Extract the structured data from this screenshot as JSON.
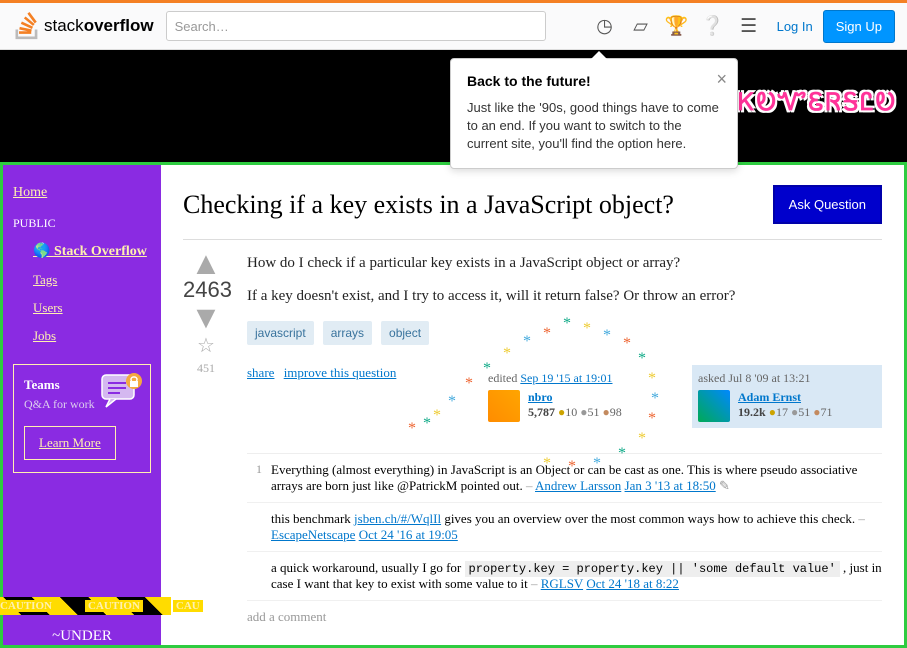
{
  "header": {
    "logo_text_a": "stack",
    "logo_text_b": "overflow",
    "search_placeholder": "Search…",
    "login": "Log In",
    "signup": "Sign Up"
  },
  "tooltip": {
    "title": "Back to the future!",
    "body": "Just like the '90s, good things have to come to an end. If you want to switch to the current site, you'll find the option here."
  },
  "retro_logo": "ᏦᎧᏉᏋᏒᎦᏝᎧ",
  "sidebar": {
    "home": "Home",
    "public": "PUBLIC",
    "so": "Stack Overflow",
    "tags": "Tags",
    "users": "Users",
    "jobs": "Jobs",
    "teams_title": "Teams",
    "teams_sub": "Q&A for work",
    "learn_more": "Learn More",
    "caution": "CAUTION",
    "under": "~UNDER"
  },
  "question": {
    "title": "Checking if a key exists in a JavaScript object?",
    "ask": "Ask Question",
    "votes": "2463",
    "favs": "451",
    "p1": "How do I check if a particular key exists in a JavaScript object or array?",
    "p2": "If a key doesn't exist, and I try to access it, will it return false? Or throw an error?",
    "tags": [
      "javascript",
      "arrays",
      "object"
    ],
    "share": "share",
    "improve": "improve this question"
  },
  "editor": {
    "action": "edited",
    "time": "Sep 19 '15 at 19:01",
    "name": "nbro",
    "rep": "5,787",
    "gold": "10",
    "silver": "51",
    "bronze": "98"
  },
  "asker": {
    "action": "asked",
    "time": "Jul 8 '09 at 13:21",
    "name": "Adam Ernst",
    "rep": "19.2k",
    "gold": "17",
    "silver": "51",
    "bronze": "71"
  },
  "comments": [
    {
      "score": "1",
      "text": "Everything (almost everything) in JavaScript is an Object or can be cast as one. This is where pseudo associative arrays are born just like @PatrickM pointed out.",
      "by": "Andrew Larsson",
      "time": "Jan 3 '13 at 18:50"
    },
    {
      "score": "",
      "text_a": "this benchmark ",
      "link": "jsben.ch/#/WqlIl",
      "text_b": " gives you an overview over the most common ways how to achieve this check.",
      "by": "EscapeNetscape",
      "time": "Oct 24 '16 at 19:05"
    },
    {
      "score": "",
      "text_a": "a quick workaround, usually I go for ",
      "code": "property.key = property.key || 'some default value'",
      "text_b": " , just in case I want that key to exist with some value to it",
      "by": "RGLSV",
      "time": "Oct 24 '18 at 8:22"
    }
  ],
  "add_comment": "add a comment"
}
